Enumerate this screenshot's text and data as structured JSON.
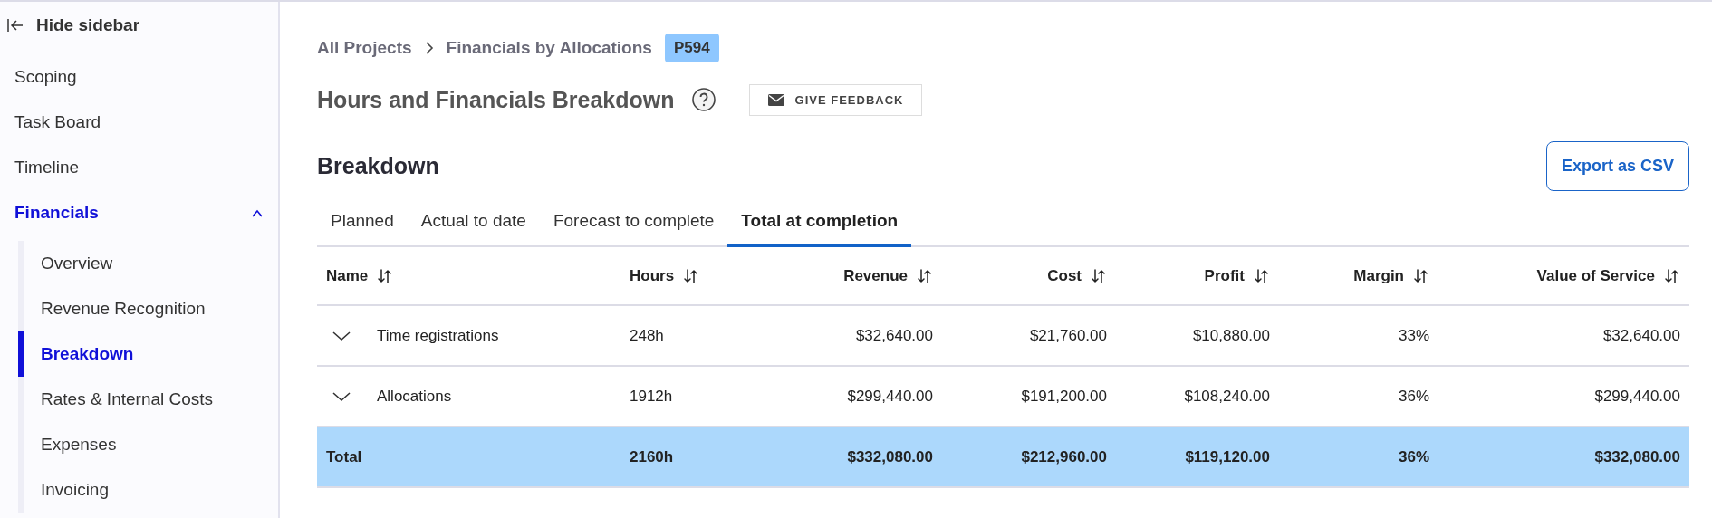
{
  "sidebar": {
    "hide_label": "Hide sidebar",
    "items": [
      {
        "label": "Scoping",
        "selected": false
      },
      {
        "label": "Task Board",
        "selected": false
      },
      {
        "label": "Timeline",
        "selected": false
      },
      {
        "label": "Financials",
        "selected": true,
        "expanded": true,
        "children": [
          {
            "label": "Overview",
            "selected": false
          },
          {
            "label": "Revenue Recognition",
            "selected": false
          },
          {
            "label": "Breakdown",
            "selected": true
          },
          {
            "label": "Rates & Internal Costs",
            "selected": false
          },
          {
            "label": "Expenses",
            "selected": false
          },
          {
            "label": "Invoicing",
            "selected": false
          }
        ]
      }
    ]
  },
  "breadcrumb": {
    "items": [
      "All Projects",
      "Financials by Allocations"
    ],
    "badge": "P594"
  },
  "page_title": "Hours and Financials Breakdown",
  "feedback_button": "GIVE FEEDBACK",
  "section": {
    "title": "Breakdown",
    "export_button": "Export as CSV"
  },
  "tabs": [
    {
      "label": "Planned",
      "selected": false
    },
    {
      "label": "Actual to date",
      "selected": false
    },
    {
      "label": "Forecast to complete",
      "selected": false
    },
    {
      "label": "Total at completion",
      "selected": true
    }
  ],
  "table": {
    "columns": [
      "Name",
      "Hours",
      "Revenue",
      "Cost",
      "Profit",
      "Margin",
      "Value of Service"
    ],
    "rows": [
      {
        "kind": "group",
        "expanded": false,
        "cells": [
          "Time registrations",
          "248h",
          "$32,640.00",
          "$21,760.00",
          "$10,880.00",
          "33%",
          "$32,640.00"
        ]
      },
      {
        "kind": "group",
        "expanded": false,
        "cells": [
          "Allocations",
          "1912h",
          "$299,440.00",
          "$191,200.00",
          "$108,240.00",
          "36%",
          "$299,440.00"
        ]
      },
      {
        "kind": "total",
        "cells": [
          "Total",
          "2160h",
          "$332,080.00",
          "$212,960.00",
          "$119,120.00",
          "36%",
          "$332,080.00"
        ]
      }
    ]
  }
}
